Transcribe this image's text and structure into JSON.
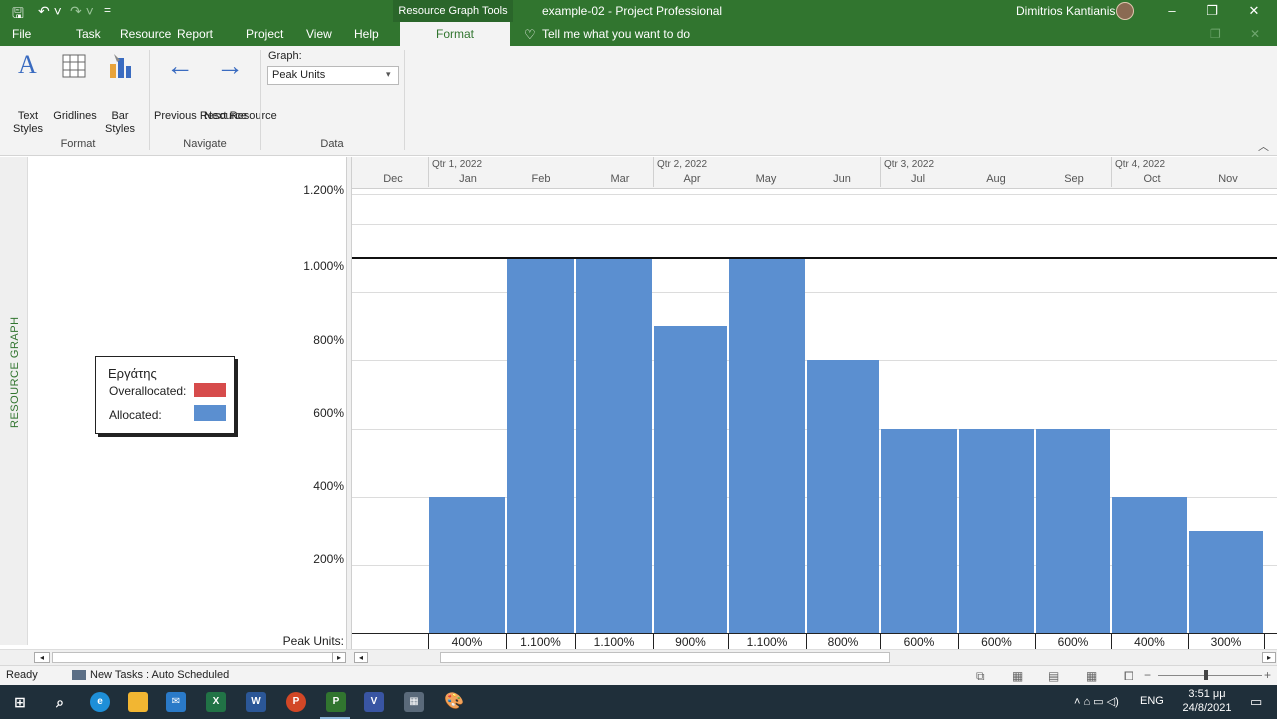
{
  "titlebar": {
    "context_tab": "Resource Graph Tools",
    "title": "example-02  -  Project Professional",
    "user": "Dimitrios Kantianis"
  },
  "menu": {
    "items": [
      "File",
      "Task",
      "Resource",
      "Report",
      "Project",
      "View",
      "Help"
    ],
    "active_tab": "Format",
    "tell_me": "Tell me what you want to do"
  },
  "ribbon": {
    "text_styles": "Text Styles",
    "gridlines": "Gridlines",
    "bar_styles": "Bar Styles",
    "format_group": "Format",
    "previous_resource": "Previous Resource",
    "next_resource": "Next Resource",
    "navigate_group": "Navigate",
    "graph_label": "Graph:",
    "graph_value": "Peak Units",
    "data_group": "Data"
  },
  "view": {
    "side_label": "RESOURCE GRAPH",
    "legend": {
      "resource": "Εργάτης",
      "overallocated": "Overallocated:",
      "allocated": "Allocated:",
      "overallocated_color": "#d64b4b",
      "allocated_color": "#5b8fd0"
    },
    "y_axis_labels": [
      "1.200%",
      "1.000%",
      "800%",
      "600%",
      "400%",
      "200%"
    ],
    "peak_units_label": "Peak Units:"
  },
  "timescale": {
    "quarters": [
      "Qtr 1, 2022",
      "Qtr 2, 2022",
      "Qtr 3, 2022",
      "Qtr 4, 2022"
    ],
    "months": [
      "Dec",
      "Jan",
      "Feb",
      "Mar",
      "Apr",
      "May",
      "Jun",
      "Jul",
      "Aug",
      "Sep",
      "Oct",
      "Nov"
    ]
  },
  "chart_data": {
    "type": "bar",
    "categories": [
      "Jan",
      "Feb",
      "Mar",
      "Apr",
      "May",
      "Jun",
      "Jul",
      "Aug",
      "Sep",
      "Oct",
      "Nov"
    ],
    "values": [
      400,
      1100,
      1100,
      900,
      1100,
      800,
      600,
      600,
      600,
      400,
      300
    ],
    "value_labels": [
      "400%",
      "1.100%",
      "1.100%",
      "900%",
      "1.100%",
      "800%",
      "600%",
      "600%",
      "600%",
      "400%",
      "300%"
    ],
    "ylim": [
      0,
      1300
    ],
    "max_units_line": 1100,
    "bar_color": "#5b8fd0"
  },
  "status": {
    "ready": "Ready",
    "new_tasks": "New Tasks : Auto Scheduled"
  },
  "taskbar": {
    "lang": "ENG",
    "time": "3:51 μμ",
    "date": "24/8/2021"
  }
}
